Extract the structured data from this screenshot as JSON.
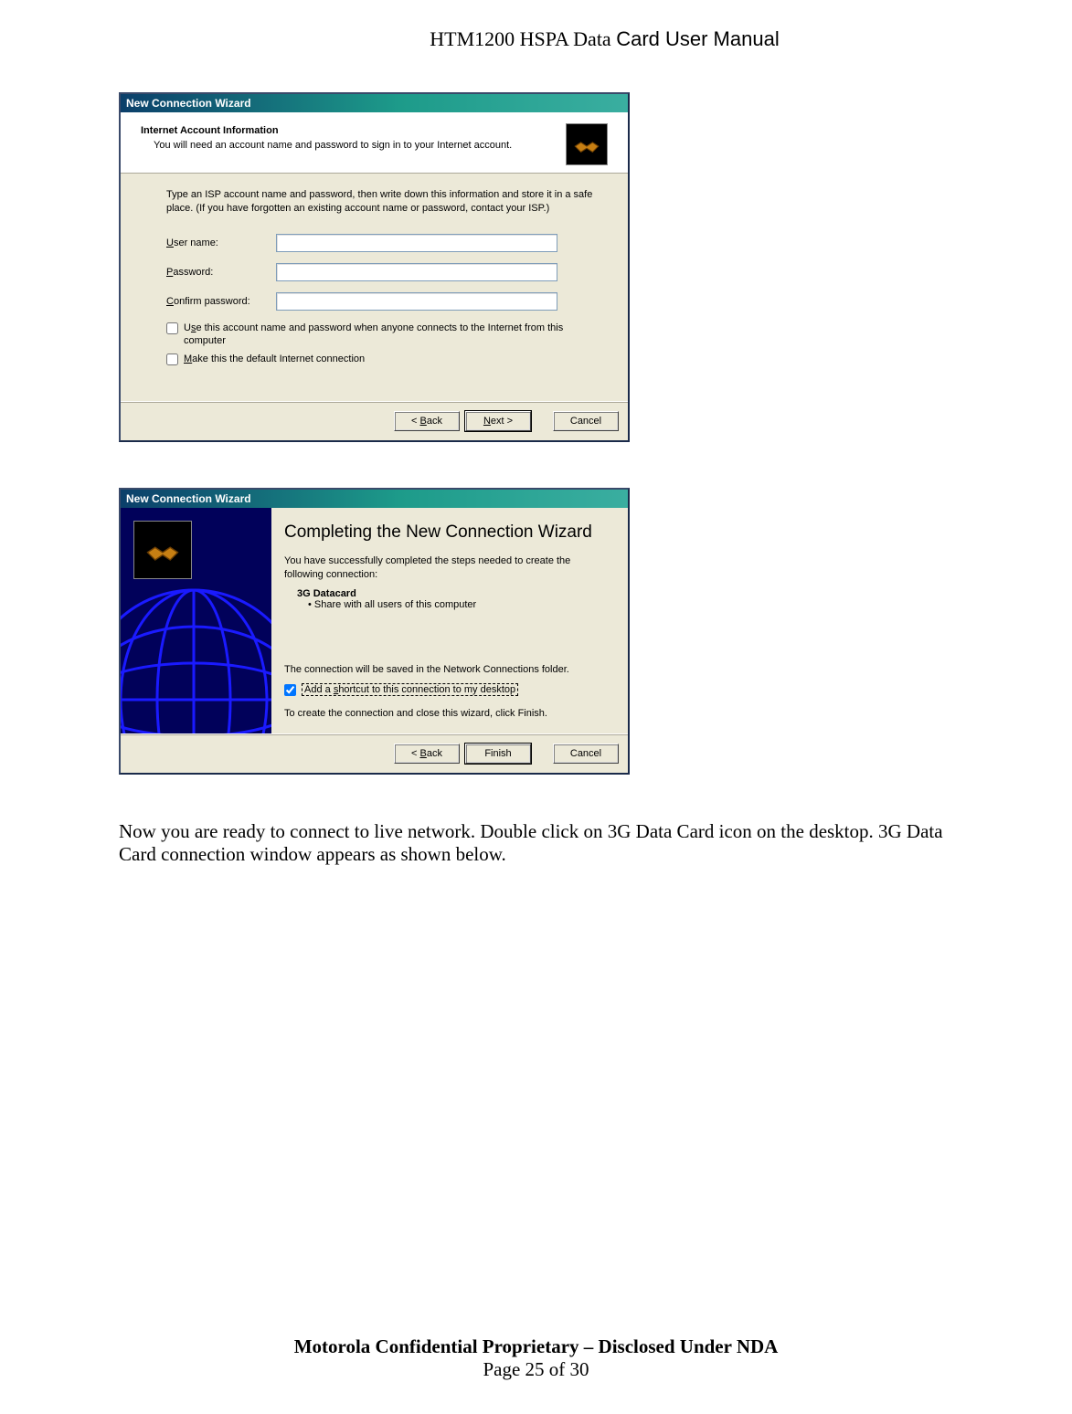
{
  "doc": {
    "header_plain": "HTM1200 HSPA Data ",
    "header_card": "Card User Manual",
    "footer_line1": "Motorola Confidential Proprietary – Disclosed Under NDA",
    "footer_line2": "Page 25 of 30",
    "body_para": "Now you are ready to connect to live network. Double click on 3G Data Card icon on the desktop. 3G Data Card connection window appears as shown below."
  },
  "dlg1": {
    "title": "New Connection Wizard",
    "header_title": "Internet Account Information",
    "header_sub": "You will need an account name and password to sign in to your Internet account.",
    "instructions": "Type an ISP account name and password, then write down this information and store it in a safe place. (If you have forgotten an existing account name or password, contact your ISP.)",
    "labels": {
      "user": "User name:",
      "user_mnemonic": "U",
      "pass": "Password:",
      "pass_mnemonic": "P",
      "confirm": "Confirm password:",
      "confirm_mnemonic": "C"
    },
    "chk1_pre": "U",
    "chk1_mid": "s",
    "chk1_post": "e this account  name and password when anyone connects to the Internet from this computer",
    "chk2_pre": "",
    "chk2_mid": "M",
    "chk2_post": "ake this the default Internet connection",
    "buttons": {
      "back_pre": "< ",
      "back_mid": "B",
      "back_post": "ack",
      "next_pre": "",
      "next_mid": "N",
      "next_post": "ext >",
      "cancel": "Cancel"
    }
  },
  "dlg2": {
    "title": "New Connection Wizard",
    "heading": "Completing the New Connection Wizard",
    "p1": "You have successfully completed the steps needed to create the following connection:",
    "conn_name": "3G Datacard",
    "bullet": "•  Share with all users of this computer",
    "p2": "The connection will be saved in the Network Connections folder.",
    "chk_pre": "Add a ",
    "chk_mid": "s",
    "chk_post": "hortcut to this connection to my desktop",
    "p3": "To create the connection and close this wizard, click Finish.",
    "buttons": {
      "back_pre": "< ",
      "back_mid": "B",
      "back_post": "ack",
      "finish": "Finish",
      "cancel": "Cancel"
    }
  }
}
